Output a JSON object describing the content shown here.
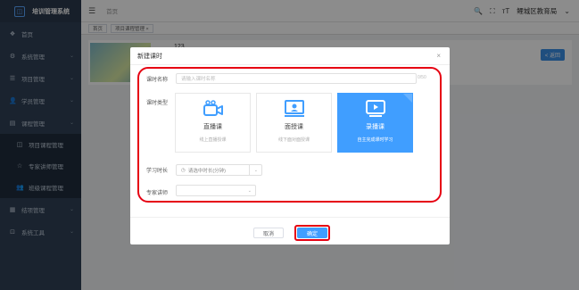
{
  "app": {
    "logo_glyph": "◫",
    "title": "培训管理系统"
  },
  "sidebar": {
    "items": [
      {
        "label": "首页",
        "icon": "dashboard-icon",
        "glyph": "❖"
      },
      {
        "label": "系统管理",
        "icon": "gear-icon",
        "glyph": "⚙"
      },
      {
        "label": "项目管理",
        "icon": "list-icon",
        "glyph": "☰"
      },
      {
        "label": "学员管理",
        "icon": "user-icon",
        "glyph": "👤"
      },
      {
        "label": "课程管理",
        "icon": "book-icon",
        "glyph": "▤"
      }
    ],
    "sub_items": [
      {
        "label": "项目课程管理",
        "icon": "book-open-icon",
        "glyph": "◫"
      },
      {
        "label": "专家讲师管理",
        "icon": "star-icon",
        "glyph": "☆"
      },
      {
        "label": "班级课程管理",
        "icon": "group-icon",
        "glyph": "👥"
      }
    ],
    "more_items": [
      {
        "label": "结项管理",
        "icon": "table-icon",
        "glyph": "▦"
      },
      {
        "label": "系统工具",
        "icon": "tool-icon",
        "glyph": "⊡"
      }
    ],
    "chevron": "⌄"
  },
  "topbar": {
    "breadcrumb": "首页",
    "search_glyph": "🔍",
    "fullscreen_glyph": "⛶",
    "font_glyph": "тT",
    "org_name": "鲤城区教育局",
    "org_arrow": "⌄"
  },
  "tags": [
    "首页",
    "项目课程管理 ×"
  ],
  "page": {
    "course_title": "123",
    "back_label": "< 返回"
  },
  "dialog": {
    "title": "新建课时",
    "close_glyph": "×",
    "name_label": "课时名称",
    "name_placeholder": "请输入课时名称",
    "name_counter": "0/50",
    "type_label": "课时类型",
    "types": [
      {
        "label": "直播课",
        "desc": "线上直播授课",
        "icon": "camera-icon",
        "selected": false
      },
      {
        "label": "面授课",
        "desc": "线下面对面授课",
        "icon": "teacher-screen-icon",
        "selected": false
      },
      {
        "label": "录播课",
        "desc": "自主完成课时学习",
        "icon": "video-play-icon",
        "selected": true
      }
    ],
    "duration_label": "学习时长",
    "duration_placeholder": "请选中时长(分钟)",
    "duration_clock_glyph": "◷",
    "expert_label": "专家讲师",
    "cancel_label": "取消",
    "ok_label": "确定"
  },
  "colors": {
    "primary": "#409eff",
    "highlight_frame": "#e60012",
    "sidebar_bg": "#304156"
  }
}
